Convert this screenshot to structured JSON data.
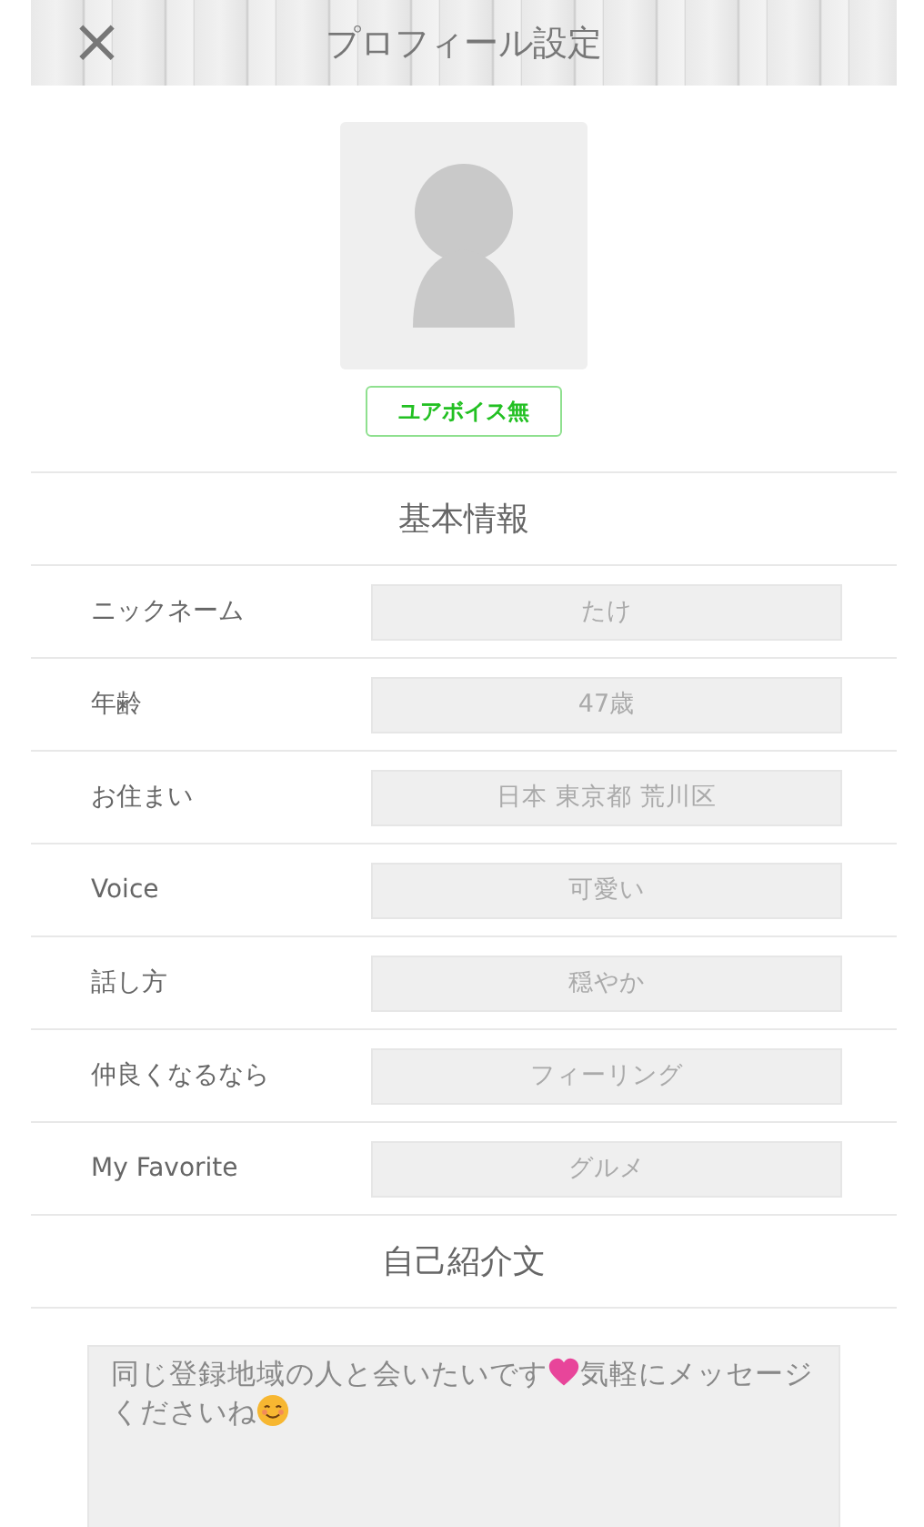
{
  "header": {
    "close": "×",
    "title": "プロフィール設定"
  },
  "avatar": {
    "badge": "ユアボイス無"
  },
  "basic": {
    "title": "基本情報",
    "rows": [
      {
        "label": "ニックネーム",
        "value": "たけ"
      },
      {
        "label": "年齢",
        "value": "47歳"
      },
      {
        "label": "お住まい",
        "value": "日本 東京都 荒川区"
      },
      {
        "label": "Voice",
        "value": "可愛い"
      },
      {
        "label": "話し方",
        "value": "穏やか"
      },
      {
        "label": "仲良くなるなら",
        "value": "フィーリング"
      },
      {
        "label": "My Favorite",
        "value": "グルメ"
      }
    ]
  },
  "intro": {
    "title": "自己紹介文",
    "parts": [
      {
        "kind": "text",
        "text": "同じ登録地域の人と会いたいです"
      },
      {
        "kind": "heart"
      },
      {
        "kind": "text",
        "text": "気軽にメッセージくださいね"
      },
      {
        "kind": "smile"
      }
    ]
  }
}
